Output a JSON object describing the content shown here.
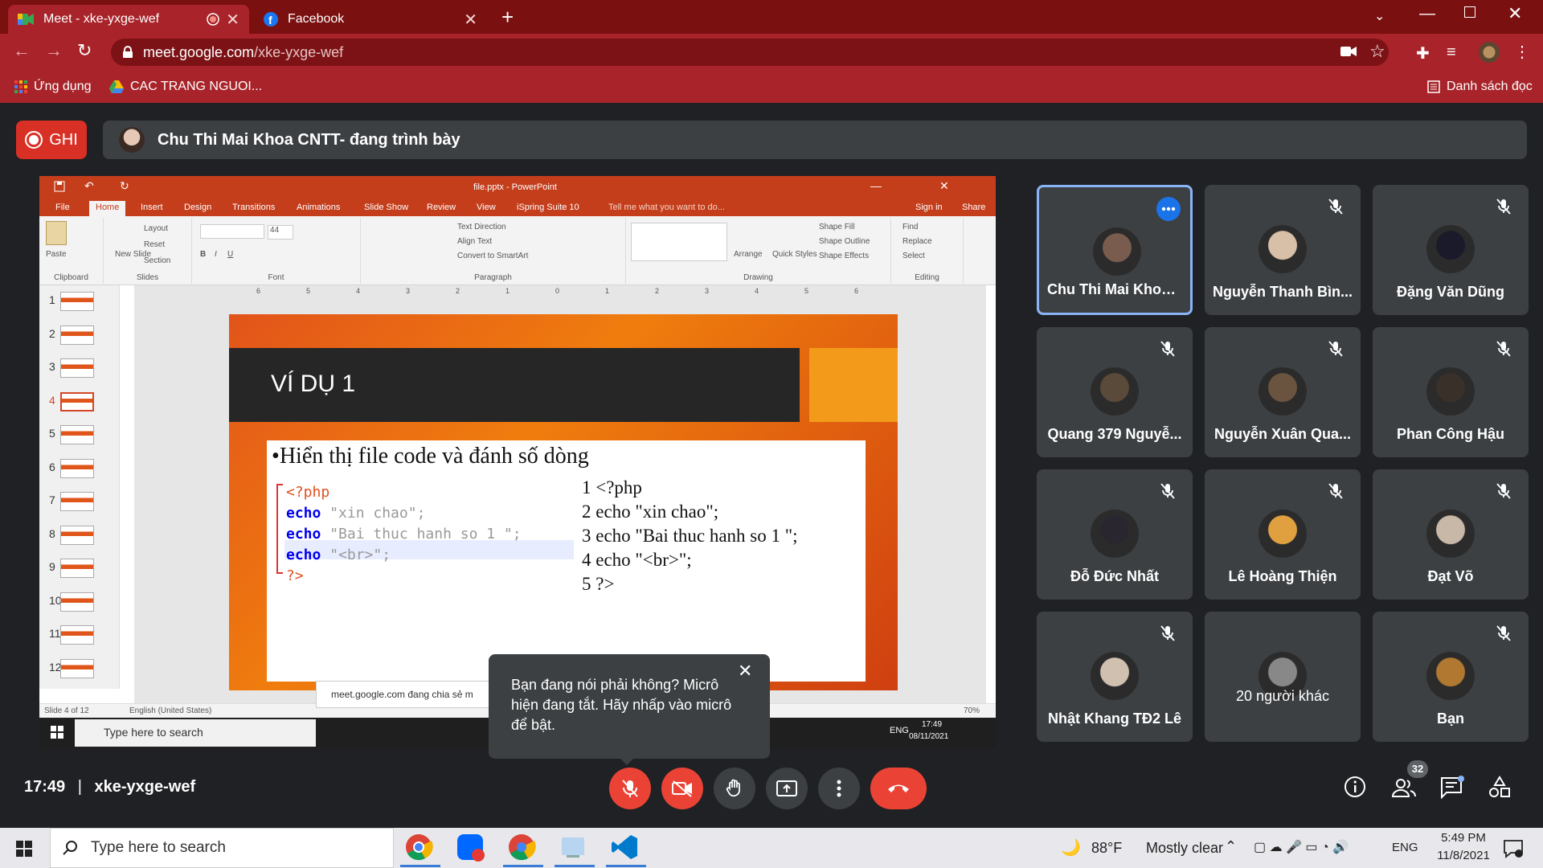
{
  "browser": {
    "tabs": [
      {
        "title": "Meet - xke-yxge-wef",
        "active": true
      },
      {
        "title": "Facebook",
        "active": false
      }
    ],
    "new_tab": "+",
    "url_host": "meet.google.com",
    "url_path": "/xke-yxge-wef",
    "bookmarks": {
      "apps": "Ứng dụng",
      "item1": "CAC TRANG NGUOI...",
      "reading_list": "Danh sách đọc"
    }
  },
  "meet": {
    "record_label": "GHI",
    "presenter_banner": "Chu Thi Mai Khoa CNTT- đang trình bày",
    "time": "17:49",
    "separator": "|",
    "meeting_code": "xke-yxge-wef",
    "participant_count": "32",
    "tooltip": "Bạn đang nói phải không? Micrô hiện đang tắt. Hãy nhấp vào micrô để bật.",
    "tooltip_close": "✕",
    "participants": [
      {
        "name": "Chu Thi Mai Khoa ...",
        "active": true
      },
      {
        "name": "Nguyễn Thanh Bìn...",
        "muted": true
      },
      {
        "name": "Đặng Văn Dũng",
        "muted": true
      },
      {
        "name": "Quang 379 Nguyễ...",
        "muted": true
      },
      {
        "name": "Nguyễn Xuân Qua...",
        "muted": true
      },
      {
        "name": "Phan Công Hậu",
        "muted": true
      },
      {
        "name": "Đỗ Đức Nhất",
        "muted": true
      },
      {
        "name": "Lê Hoàng Thiện",
        "muted": true
      },
      {
        "name": "Đạt Võ",
        "muted": true
      },
      {
        "name": "Nhật Khang TĐ2 Lê",
        "muted": true
      },
      {
        "name": "20 người khác",
        "muted": false
      },
      {
        "name": "Bạn",
        "muted": true
      }
    ]
  },
  "powerpoint": {
    "title": "file.pptx - PowerPoint",
    "tabs": [
      "File",
      "Home",
      "Insert",
      "Design",
      "Transitions",
      "Animations",
      "Slide Show",
      "Review",
      "View",
      "iSpring Suite 10"
    ],
    "tell_me": "Tell me what you want to do...",
    "sign_in": "Sign in",
    "share": "Share",
    "ribbon": {
      "paste": "Paste",
      "new_slide": "New Slide",
      "layout": "Layout",
      "reset": "Reset",
      "section": "Section",
      "font_size": "44",
      "text_direction": "Text Direction",
      "align_text": "Align Text",
      "convert_smartart": "Convert to SmartArt",
      "arrange": "Arrange",
      "quick_styles": "Quick Styles",
      "shape_fill": "Shape Fill",
      "shape_outline": "Shape Outline",
      "shape_effects": "Shape Effects",
      "find": "Find",
      "replace": "Replace",
      "select": "Select",
      "groups": [
        "Clipboard",
        "Slides",
        "Font",
        "Paragraph",
        "Drawing",
        "Editing"
      ]
    },
    "ruler_numbers": [
      "6",
      "5",
      "4",
      "3",
      "2",
      "1",
      "0",
      "1",
      "2",
      "3",
      "4",
      "5",
      "6"
    ],
    "thumbnails": [
      "1",
      "2",
      "3",
      "4",
      "5",
      "6",
      "7",
      "8",
      "9",
      "10",
      "11",
      "12"
    ],
    "selected_slide": 4,
    "slide": {
      "title": "VÍ DỤ 1",
      "bullet": "Hiển thị file code và đánh số dòng",
      "code_lines": [
        {
          "parts": [
            {
              "t": "<?php",
              "c": "php"
            }
          ]
        },
        {
          "parts": [
            {
              "t": "echo",
              "c": "kw"
            },
            {
              "t": " \"xin chao\";",
              "c": "str"
            }
          ]
        },
        {
          "parts": [
            {
              "t": "echo",
              "c": "kw"
            },
            {
              "t": " \"Bai thuc hanh so 1 \";",
              "c": "str"
            }
          ]
        },
        {
          "parts": [
            {
              "t": "echo",
              "c": "kw"
            },
            {
              "t": " \"<br>\";",
              "c": "str"
            }
          ]
        },
        {
          "parts": [
            {
              "t": "?>",
              "c": "php"
            }
          ]
        }
      ],
      "numbered_lines": [
        "1 <?php",
        "2 echo \"xin chao\";",
        "3 echo \"Bai thuc hanh so 1 \";",
        "4 echo \"<br>\";",
        "5 ?>"
      ]
    },
    "status": {
      "slide_of": "Slide 4 of 12",
      "language": "English (United States)",
      "zoom": "70%"
    },
    "share_notice": "meet.google.com đang chia sẻ m",
    "inner_taskbar": {
      "search": "Type here to search",
      "lang": "ENG",
      "time": "17:49",
      "date": "08/11/2021"
    }
  },
  "taskbar": {
    "search": "Type here to search",
    "weather_temp": "88°F",
    "weather_desc": "Mostly clear",
    "lang": "ENG",
    "time": "5:49 PM",
    "date": "11/8/2021"
  },
  "colors": {
    "chrome_red": "#a8242a",
    "meet_bg": "#202124",
    "tile_bg": "#3c4043",
    "danger": "#ea4335",
    "accent_blue": "#8ab4f8"
  }
}
